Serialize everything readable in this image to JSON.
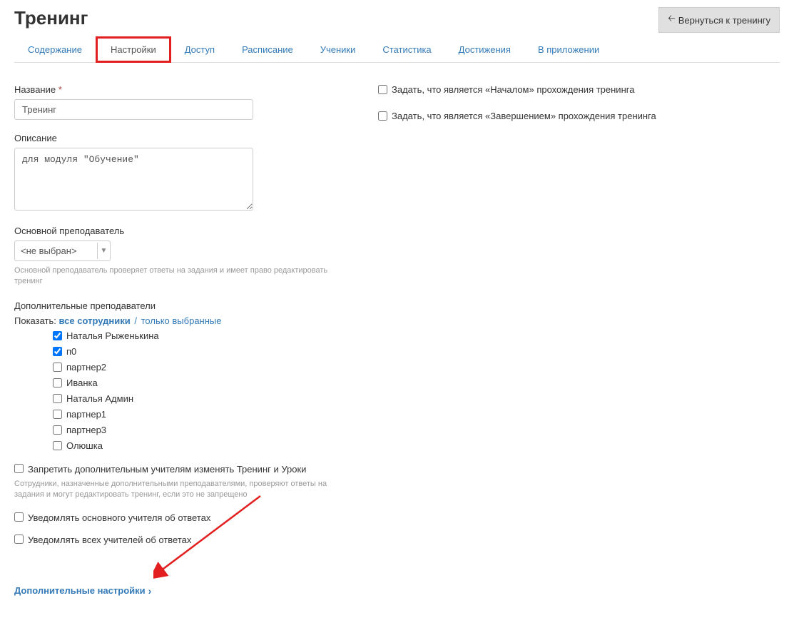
{
  "header": {
    "title": "Тренинг",
    "back_button": "Вернуться к тренингу"
  },
  "tabs": [
    {
      "label": "Содержание",
      "active": false
    },
    {
      "label": "Настройки",
      "active": true
    },
    {
      "label": "Доступ",
      "active": false
    },
    {
      "label": "Расписание",
      "active": false
    },
    {
      "label": "Ученики",
      "active": false
    },
    {
      "label": "Статистика",
      "active": false
    },
    {
      "label": "Достижения",
      "active": false
    },
    {
      "label": "В приложении",
      "active": false
    }
  ],
  "form": {
    "name_label": "Название",
    "required_mark": "*",
    "name_value": "Тренинг",
    "desc_label": "Описание",
    "desc_value": "для модуля \"Обучение\"",
    "main_teacher_label": "Основной преподаватель",
    "main_teacher_value": "<не выбран>",
    "main_teacher_hint": "Основной преподаватель проверяет ответы на задания и имеет право редактировать тренинг",
    "addl_teachers_label": "Дополнительные преподаватели",
    "filter_prefix": "Показать:",
    "filter_all": "все сотрудники",
    "filter_selected": "только выбранные",
    "teachers": [
      {
        "name": "Наталья Рыженькина",
        "checked": true
      },
      {
        "name": "п0",
        "checked": true
      },
      {
        "name": "партнер2",
        "checked": false
      },
      {
        "name": "Иванка",
        "checked": false
      },
      {
        "name": "Наталья Админ",
        "checked": false
      },
      {
        "name": "партнер1",
        "checked": false
      },
      {
        "name": "партнер3",
        "checked": false
      },
      {
        "name": "Олюшка",
        "checked": false
      }
    ],
    "forbid_edit_label": "Запретить дополнительным учителям изменять Тренинг и Уроки",
    "forbid_edit_hint": "Сотрудники, назначенные дополнительными преподавателями, проверяют ответы на задания и могут редактировать тренинг, если это не запрещено",
    "notify_main_label": "Уведомлять основного учителя об ответах",
    "notify_all_label": "Уведомлять всех учителей об ответах",
    "more_settings": "Дополнительные настройки"
  },
  "right": {
    "start_label": "Задать, что является «Началом» прохождения тренинга",
    "end_label": "Задать, что является «Завершением» прохождения тренинга"
  },
  "colors": {
    "link": "#337ab7",
    "highlight": "#e21e1e",
    "arrow": "#e21e1e"
  }
}
